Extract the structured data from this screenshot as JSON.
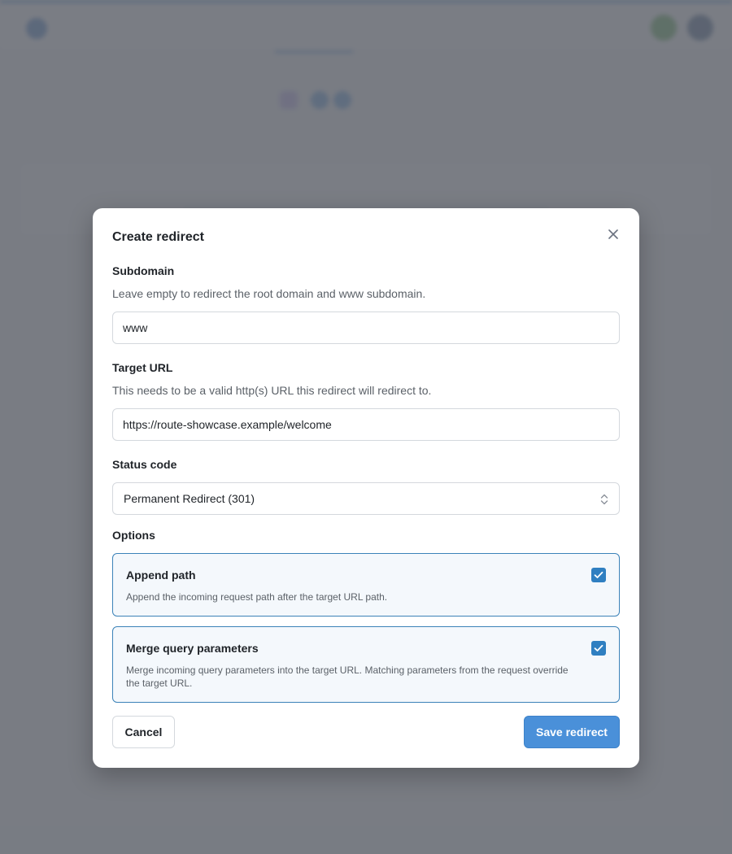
{
  "background": {
    "brand": "",
    "nav_items": [
      "",
      "",
      "",
      "",
      ""
    ],
    "breadcrumbs": [
      "",
      "",
      ""
    ],
    "page_title": "",
    "section_title": "",
    "empty_title": ""
  },
  "modal": {
    "title": "Create redirect",
    "subdomain": {
      "label": "Subdomain",
      "help": "Leave empty to redirect the root domain and www subdomain.",
      "value": "www"
    },
    "target_url": {
      "label": "Target URL",
      "help": "This needs to be a valid http(s) URL this redirect will redirect to.",
      "value": "https://route-showcase.example/welcome"
    },
    "status_code": {
      "label": "Status code",
      "selected": "Permanent Redirect (301)"
    },
    "options": {
      "label": "Options",
      "items": [
        {
          "title": "Append path",
          "description": "Append the incoming request path after the target URL path.",
          "checked": true
        },
        {
          "title": "Merge query parameters",
          "description": "Merge incoming query parameters into the target URL. Matching parameters from the request override the target URL.",
          "checked": true
        }
      ]
    },
    "cancel_label": "Cancel",
    "save_label": "Save redirect"
  },
  "colors": {
    "accent": "#4a90d9",
    "checkbox": "#2f7fc1",
    "option_border": "#3b82b8",
    "overlay": "#646870"
  },
  "icons": {
    "close": "close-icon",
    "select": "chevron-updown-icon",
    "check": "check-icon"
  }
}
